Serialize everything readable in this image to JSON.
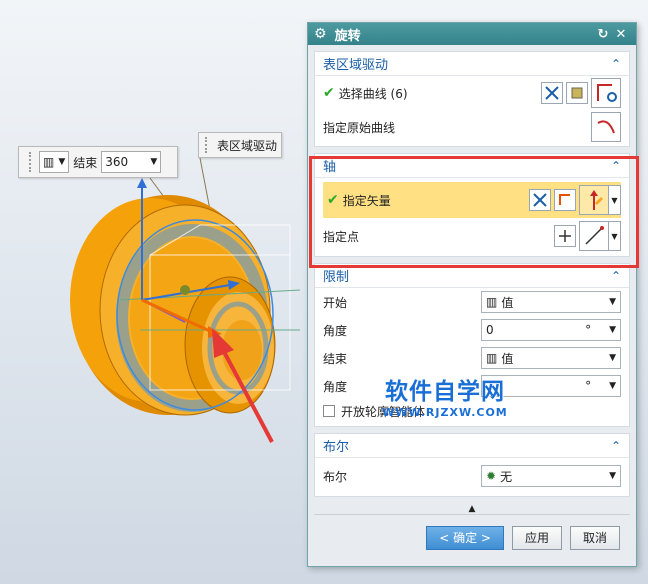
{
  "viewport": {
    "float_bar": {
      "end_label": "结束",
      "end_value": "360"
    },
    "tag_label": "表区域驱动",
    "watermark": {
      "title": "软件自学网",
      "url": "WWW.RJZXW.COM"
    }
  },
  "dialog": {
    "title": "旋转",
    "sections": {
      "surface": {
        "header": "表区域驱动",
        "select_curve_label": "选择曲线 (6)",
        "origin_curve_label": "指定原始曲线"
      },
      "axis": {
        "header": "轴",
        "vector_label": "指定矢量",
        "point_label": "指定点"
      },
      "limits": {
        "header": "限制",
        "start_label": "开始",
        "start_value": "值",
        "angle1_label": "角度",
        "angle1_value": "0",
        "angle1_unit": "°",
        "end_label": "结束",
        "end_value": "值",
        "angle2_label": "角度",
        "angle2_unit": "°",
        "open_profile_label": "开放轮廓智能体"
      },
      "boolean": {
        "header": "布尔",
        "bool_label": "布尔",
        "bool_value": "无"
      }
    },
    "buttons": {
      "ok": "< 确定 >",
      "apply": "应用",
      "cancel": "取消"
    }
  },
  "colors": {
    "accent": "#34838a",
    "highlight": "#ffe082",
    "annotation_frame": "#e53935",
    "part_orange": "#f5a20a"
  }
}
